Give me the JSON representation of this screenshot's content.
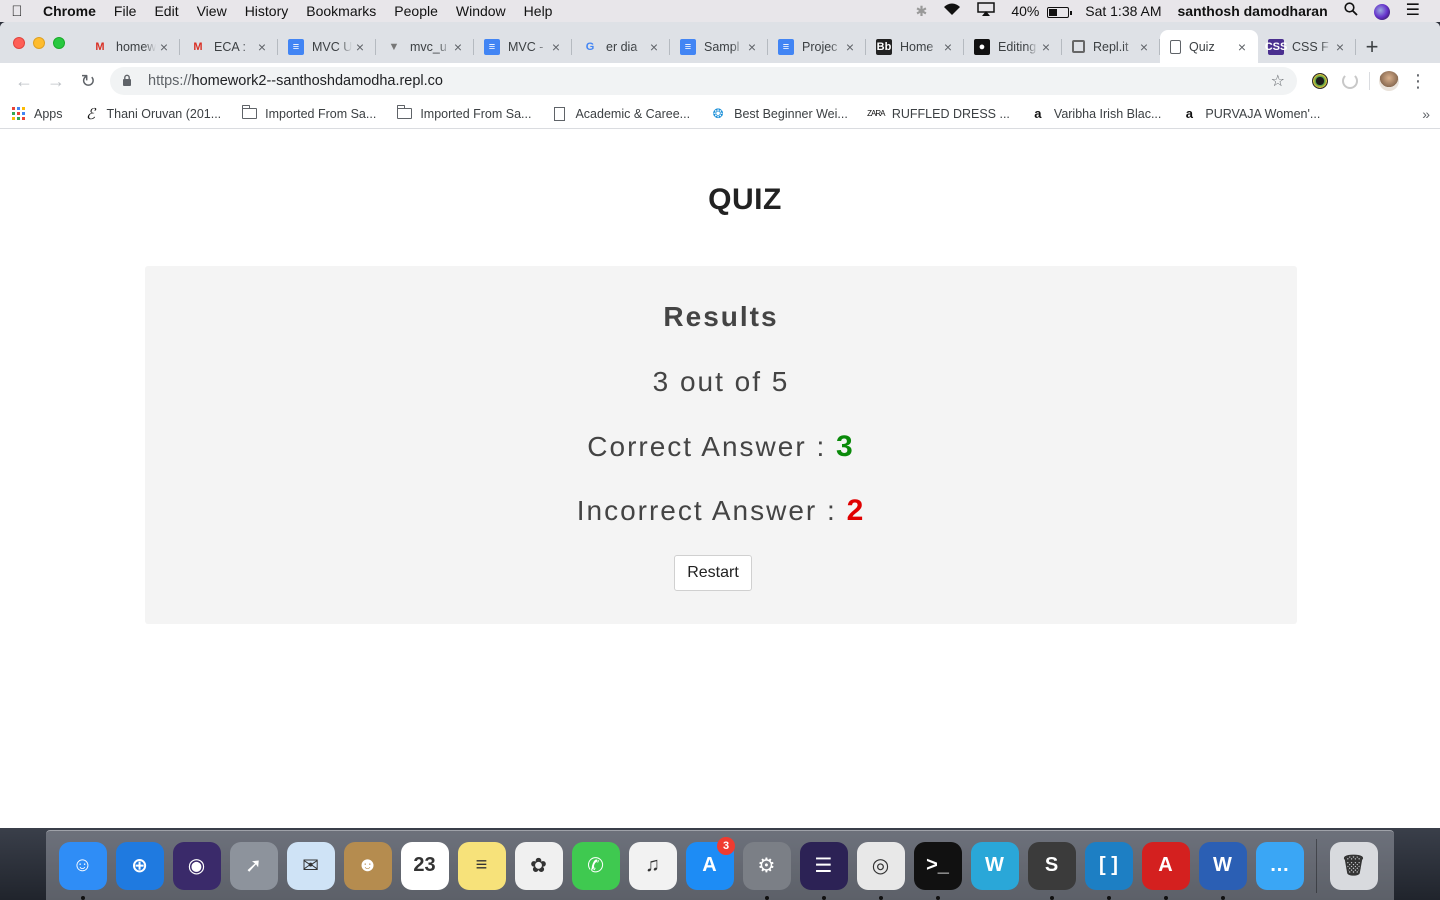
{
  "menubar": {
    "app": "Chrome",
    "menus": [
      "File",
      "Edit",
      "View",
      "History",
      "Bookmarks",
      "People",
      "Window",
      "Help"
    ],
    "battery_pct": "40%",
    "battery_level": 0.4,
    "clock": "Sat 1:38 AM",
    "user": "santhosh damodharan"
  },
  "tabs": [
    {
      "title": "homew",
      "icon": "gmail-icon"
    },
    {
      "title": "ECA :",
      "icon": "gmail-icon"
    },
    {
      "title": "MVC U",
      "icon": "docs-icon"
    },
    {
      "title": "mvc_u",
      "icon": "file-icon"
    },
    {
      "title": "MVC -",
      "icon": "docs-icon"
    },
    {
      "title": "er dia",
      "icon": "google-icon"
    },
    {
      "title": "Sampl",
      "icon": "docs-icon"
    },
    {
      "title": "Projec",
      "icon": "docs-icon"
    },
    {
      "title": "Home",
      "icon": "blackboard-icon"
    },
    {
      "title": "Editing",
      "icon": "github-icon"
    },
    {
      "title": "Repl.it",
      "icon": "repl-icon"
    },
    {
      "title": "Quiz",
      "icon": "page-icon",
      "active": true
    },
    {
      "title": "CSS F",
      "icon": "css-icon"
    }
  ],
  "toolbar": {
    "url_scheme": "https://",
    "url_host": "homework2--santhoshdamodha.repl.co"
  },
  "bookmarks": {
    "apps_label": "Apps",
    "items": [
      {
        "label": "Thani Oruvan (201...",
        "icon": "thani-icon"
      },
      {
        "label": "Imported From Sa...",
        "icon": "folder-icon"
      },
      {
        "label": "Imported From Sa...",
        "icon": "folder-icon"
      },
      {
        "label": "Academic & Caree...",
        "icon": "page-icon"
      },
      {
        "label": "Best Beginner Wei...",
        "icon": "site-icon"
      },
      {
        "label": "RUFFLED DRESS ...",
        "icon": "zara-icon"
      },
      {
        "label": "Varibha Irish Blac...",
        "icon": "amazon-icon"
      },
      {
        "label": "PURVAJA Women'...",
        "icon": "amazon-icon"
      }
    ],
    "overflow": "»"
  },
  "page": {
    "title": "QUIZ",
    "results_heading": "Results",
    "score_text": "3 out of 5",
    "correct_label": "Correct Answer : ",
    "correct_value": "3",
    "incorrect_label": "Incorrect Answer : ",
    "incorrect_value": "2",
    "restart_label": "Restart"
  },
  "dock": {
    "items": [
      {
        "name": "finder-icon",
        "color": "#2f8df6",
        "glyph": "☺",
        "running": true
      },
      {
        "name": "safari-icon",
        "color": "#1f7ae0",
        "glyph": "⊕",
        "running": false
      },
      {
        "name": "siri-icon",
        "color": "#3a2a6a",
        "glyph": "◉",
        "running": false
      },
      {
        "name": "launchpad-icon",
        "color": "#8d939c",
        "glyph": "➚",
        "running": false
      },
      {
        "name": "mail-icon",
        "color": "#cfe3f6",
        "glyph": "✉",
        "running": false
      },
      {
        "name": "contacts-icon",
        "color": "#b58c4f",
        "glyph": "☻",
        "running": false
      },
      {
        "name": "calendar-icon",
        "color": "#ffffff",
        "glyph": "23",
        "running": false
      },
      {
        "name": "notes-icon",
        "color": "#f7e27a",
        "glyph": "≡",
        "running": false
      },
      {
        "name": "photos-icon",
        "color": "#f0f0f0",
        "glyph": "✿",
        "running": false
      },
      {
        "name": "facetime-icon",
        "color": "#3fc950",
        "glyph": "✆",
        "running": false
      },
      {
        "name": "itunes-icon",
        "color": "#f2f2f2",
        "glyph": "♫",
        "running": false
      },
      {
        "name": "app-store-icon",
        "color": "#1d8cf5",
        "glyph": "A",
        "running": false,
        "badge": "3"
      },
      {
        "name": "system-preferences-icon",
        "color": "#7b7f86",
        "glyph": "⚙",
        "running": true
      },
      {
        "name": "eclipse-icon",
        "color": "#2c2255",
        "glyph": "☰",
        "running": true
      },
      {
        "name": "chrome-icon",
        "color": "#e8e8e8",
        "glyph": "◎",
        "running": true
      },
      {
        "name": "terminal-icon",
        "color": "#111111",
        "glyph": ">_",
        "running": true
      },
      {
        "name": "webstorm-icon",
        "color": "#2aa7d8",
        "glyph": "W",
        "running": false
      },
      {
        "name": "sublime-icon",
        "color": "#3b3b3b",
        "glyph": "S",
        "running": true
      },
      {
        "name": "brackets-icon",
        "color": "#1d7fc4",
        "glyph": "[ ]",
        "running": true
      },
      {
        "name": "acrobat-icon",
        "color": "#d4201f",
        "glyph": "A",
        "running": true
      },
      {
        "name": "word-icon",
        "color": "#2b5fb4",
        "glyph": "W",
        "running": true
      },
      {
        "name": "messages-icon",
        "color": "#3aa6f5",
        "glyph": "…",
        "running": false
      }
    ],
    "trash": {
      "name": "trash-icon",
      "color": "#d8dade",
      "glyph": "🗑"
    }
  },
  "colors": {
    "correct": "#0a8a0a",
    "incorrect": "#e00000",
    "card_bg": "#f4f4f4"
  }
}
